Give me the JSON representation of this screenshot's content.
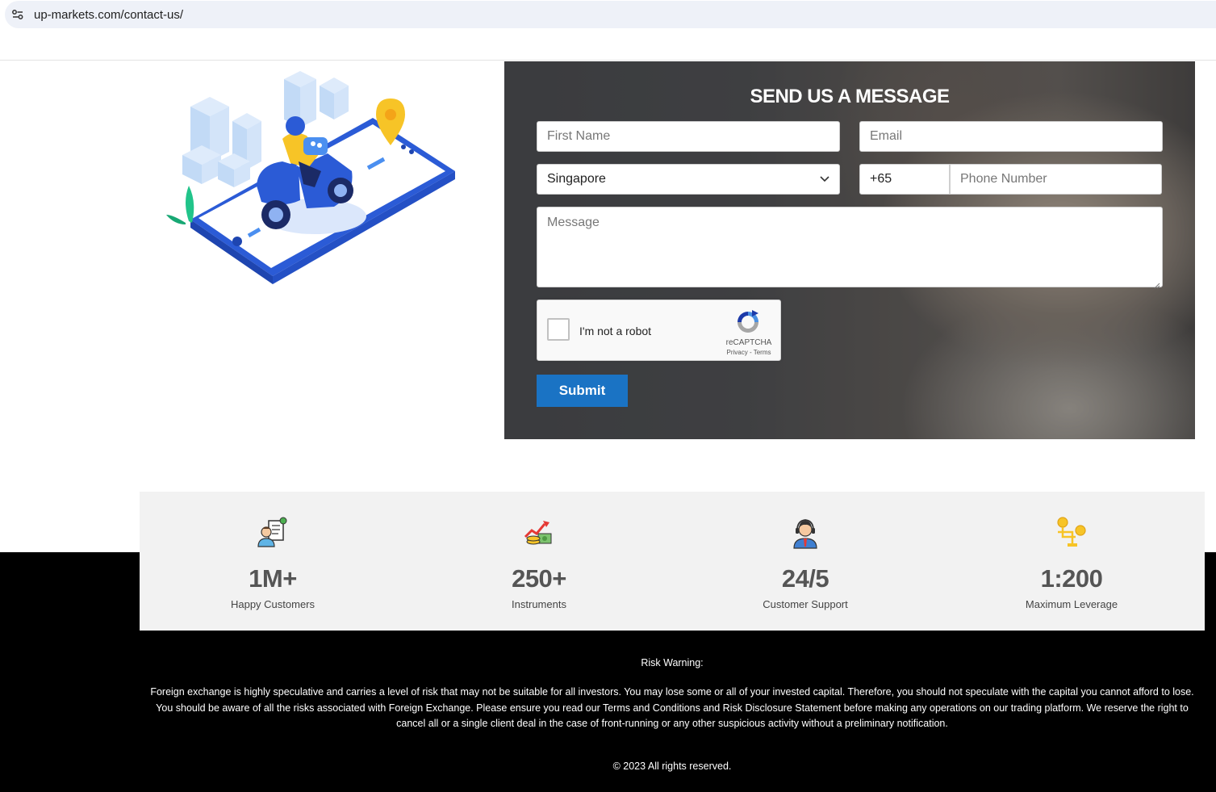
{
  "browser": {
    "url": "up-markets.com/contact-us/"
  },
  "form": {
    "title": "SEND US A MESSAGE",
    "first_name_placeholder": "First Name",
    "email_placeholder": "Email",
    "country_value": "Singapore",
    "phone_code": "+65",
    "phone_placeholder": "Phone Number",
    "message_placeholder": "Message",
    "captcha_label": "I'm not a robot",
    "captcha_brand": "reCAPTCHA",
    "captcha_links": "Privacy - Terms",
    "submit_label": "Submit"
  },
  "stats": [
    {
      "value": "1M+",
      "label": "Happy Customers",
      "icon": "customer-icon"
    },
    {
      "value": "250+",
      "label": "Instruments",
      "icon": "growth-chart-icon"
    },
    {
      "value": "24/5",
      "label": "Customer Support",
      "icon": "support-agent-icon"
    },
    {
      "value": "1:200",
      "label": "Maximum Leverage",
      "icon": "leverage-coins-icon"
    }
  ],
  "footer": {
    "risk_title": "Risk Warning:",
    "risk_text": "Foreign exchange is highly speculative and carries a level of risk that may not be suitable for all investors. You may lose some or all of your invested capital. Therefore, you should not speculate with the capital you cannot afford to lose. You should be aware of all the risks associated with Foreign Exchange. Please ensure you read our Terms and Conditions and Risk Disclosure Statement before making any operations on our trading platform. We reserve the right to cancel all or a single client deal in the case of front-running or any other suspicious activity without a preliminary notification.",
    "copyright": "© 2023 All rights reserved."
  },
  "colors": {
    "accent": "#1a73c4",
    "footer_bg": "#000000",
    "stats_bg": "#f2f2f2"
  }
}
